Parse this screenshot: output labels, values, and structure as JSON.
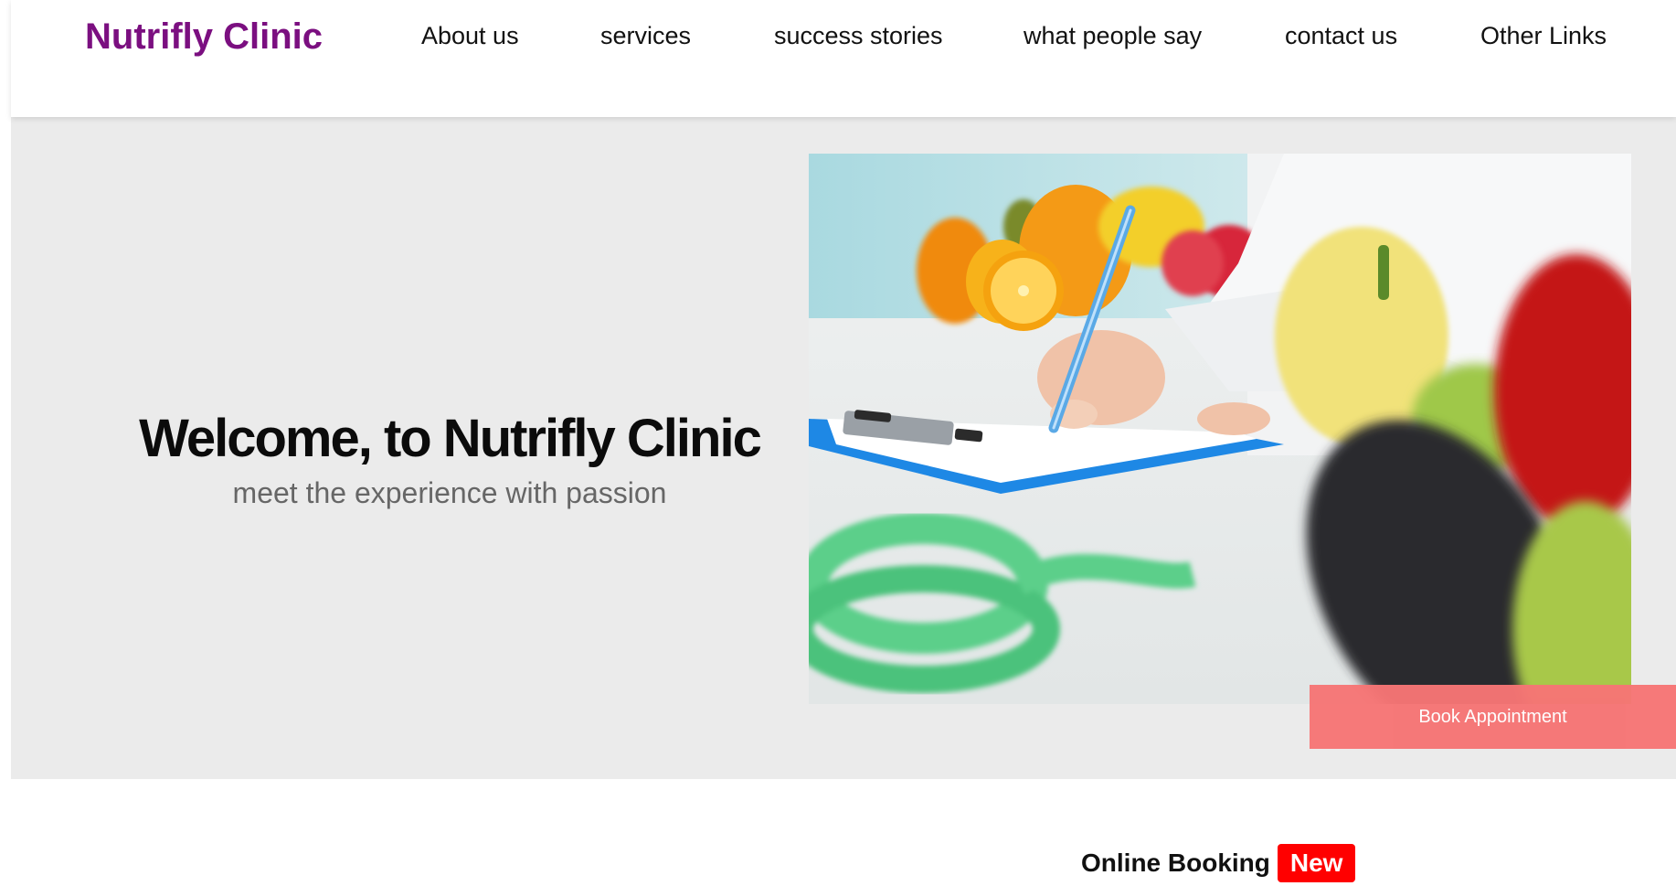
{
  "header": {
    "brand": "Nutrifly Clinic",
    "nav": [
      {
        "label": "About us"
      },
      {
        "label": "services"
      },
      {
        "label": "success stories"
      },
      {
        "label": "what people say"
      },
      {
        "label": "contact us"
      },
      {
        "label": "Other Links"
      }
    ]
  },
  "hero": {
    "title": "Welcome, to Nutrifly Clinic",
    "subtitle": "meet the experience with passion"
  },
  "booking": {
    "label": "Online Booking",
    "badge": "New",
    "button_label": "Book Appointment"
  },
  "colors": {
    "brand": "#7b0f80",
    "hero_background": "#ebebeb",
    "badge": "#ff0000",
    "book_button": "#f67575"
  }
}
